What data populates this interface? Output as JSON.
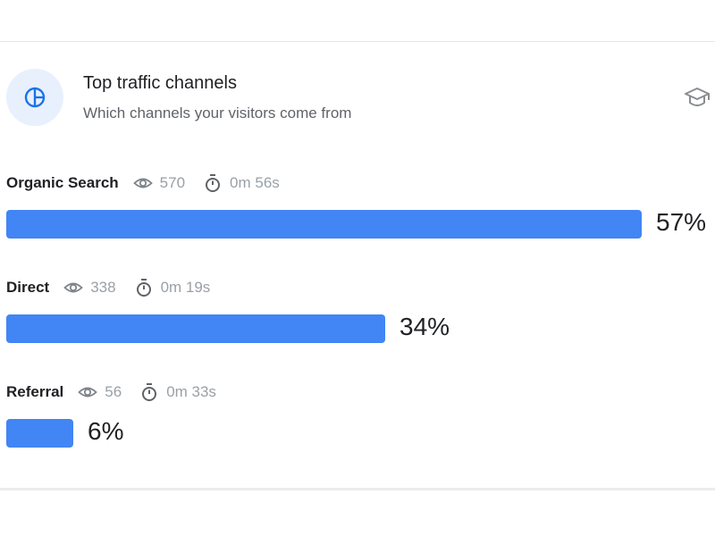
{
  "header": {
    "title": "Top traffic channels",
    "subtitle": "Which channels your visitors come from",
    "icon": "pie-chart-icon",
    "action_icon": "graduation-cap-icon"
  },
  "colors": {
    "accent": "#4285f4",
    "icon_bg": "#e8f0fe",
    "muted_text": "#9aa0a6"
  },
  "channels": [
    {
      "name": "Organic Search",
      "views": "570",
      "duration": "0m 56s",
      "percent_label": "57%",
      "percent": 57
    },
    {
      "name": "Direct",
      "views": "338",
      "duration": "0m 19s",
      "percent_label": "34%",
      "percent": 34
    },
    {
      "name": "Referral",
      "views": "56",
      "duration": "0m 33s",
      "percent_label": "6%",
      "percent": 6
    }
  ]
}
